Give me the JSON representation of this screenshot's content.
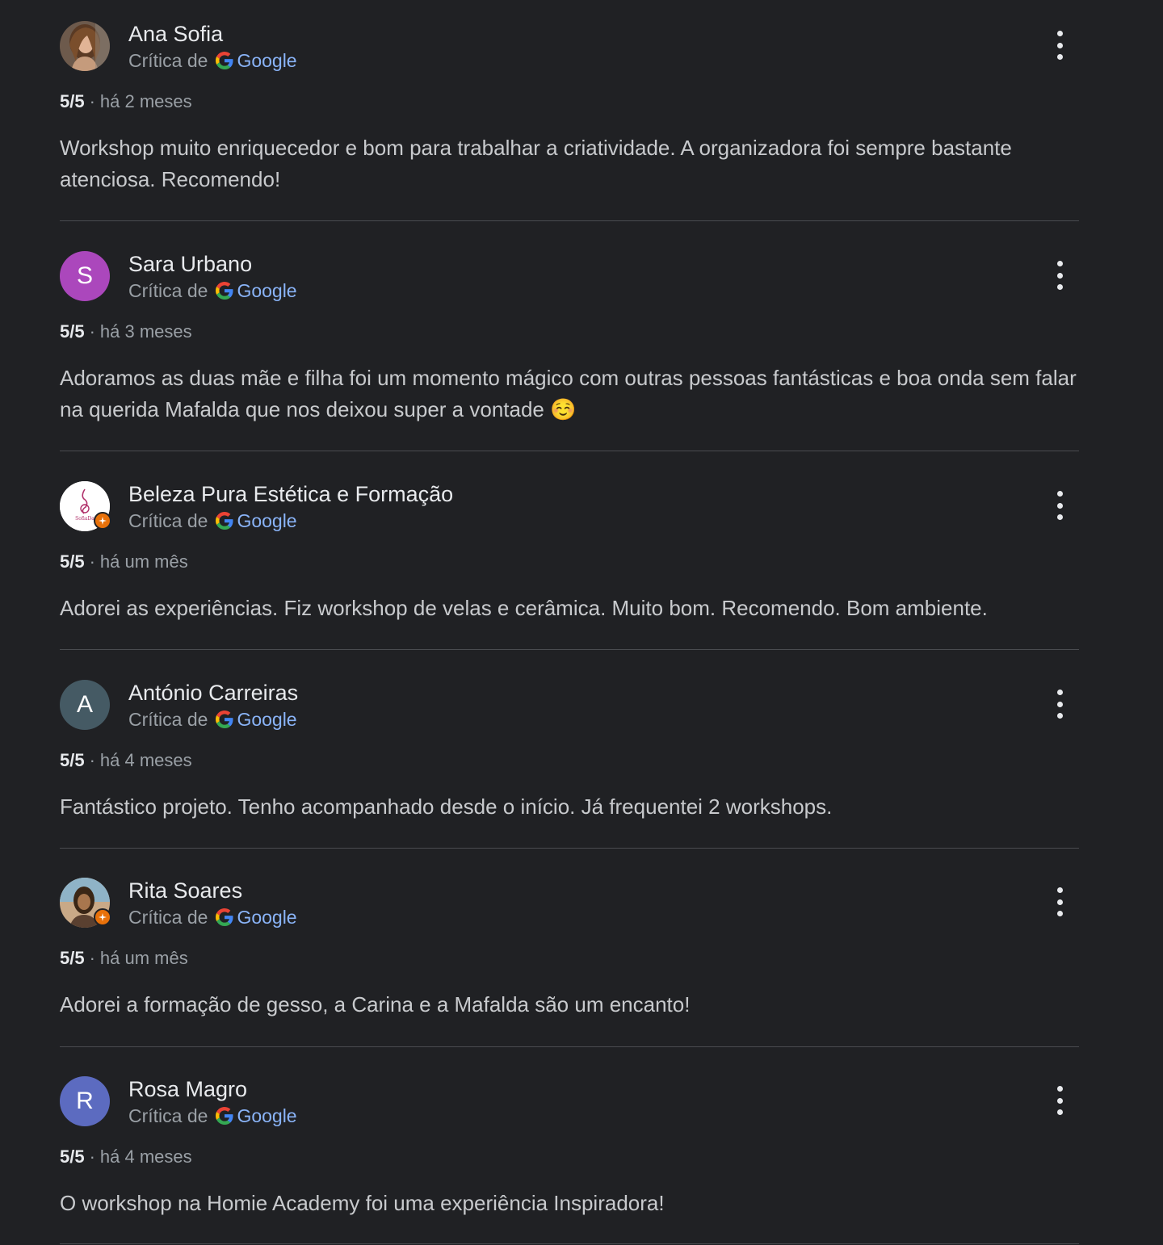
{
  "reviews": [
    {
      "name": "Ana Sofia",
      "source_prefix": "Crítica de",
      "source_name": "Google",
      "avatar_icon": "photo-woman-long-hair",
      "score": "5/5",
      "separator": "·",
      "time": "há 2 meses",
      "text": "Workshop muito enriquecedor e bom para trabalhar a criatividade. A organizadora foi sempre bastante atenciosa. Recomendo!"
    },
    {
      "name": "Sara Urbano",
      "source_prefix": "Crítica de",
      "source_name": "Google",
      "avatar_initial": "S",
      "avatar_color": "#ab47bc",
      "score": "5/5",
      "separator": "·",
      "time": "há 3 meses",
      "text": "Adoramos as duas mãe e filha foi um momento mágico com outras pessoas fantásticas e boa onda sem falar na querida Mafalda que nos deixou super a vontade ☺️"
    },
    {
      "name": "Beleza Pura Estética e Formação",
      "source_prefix": "Crítica de",
      "source_name": "Google",
      "avatar_icon": "business-logo",
      "badge_icon": "local-guide-badge-icon",
      "score": "5/5",
      "separator": "·",
      "time": "há um mês",
      "text": "Adorei as experiências. Fiz workshop de velas e cerâmica. Muito bom. Recomendo. Bom ambiente."
    },
    {
      "name": "António Carreiras",
      "source_prefix": "Crítica de",
      "source_name": "Google",
      "avatar_initial": "A",
      "avatar_color": "#455a64",
      "score": "5/5",
      "separator": "·",
      "time": "há 4 meses",
      "text": "Fantástico projeto. Tenho acompanhado desde o início. Já frequentei 2 workshops."
    },
    {
      "name": "Rita Soares",
      "source_prefix": "Crítica de",
      "source_name": "Google",
      "avatar_icon": "photo-woman",
      "badge_icon": "local-guide-badge-icon",
      "score": "5/5",
      "separator": "·",
      "time": "há um mês",
      "text": "Adorei a formação de gesso, a Carina e a Mafalda são um encanto!"
    },
    {
      "name": "Rosa Magro",
      "source_prefix": "Crítica de",
      "source_name": "Google",
      "avatar_initial": "R",
      "avatar_color": "#5c6bc0",
      "score": "5/5",
      "separator": "·",
      "time": "há 4 meses",
      "text": "O workshop na Homie Academy foi uma experiência Inspiradora!"
    }
  ],
  "colors": {
    "background": "#202124",
    "text_primary": "#e8eaed",
    "text_secondary": "#9aa0a6",
    "link": "#8ab4f8",
    "divider": "#4a4c50",
    "badge": "#e8710a"
  }
}
